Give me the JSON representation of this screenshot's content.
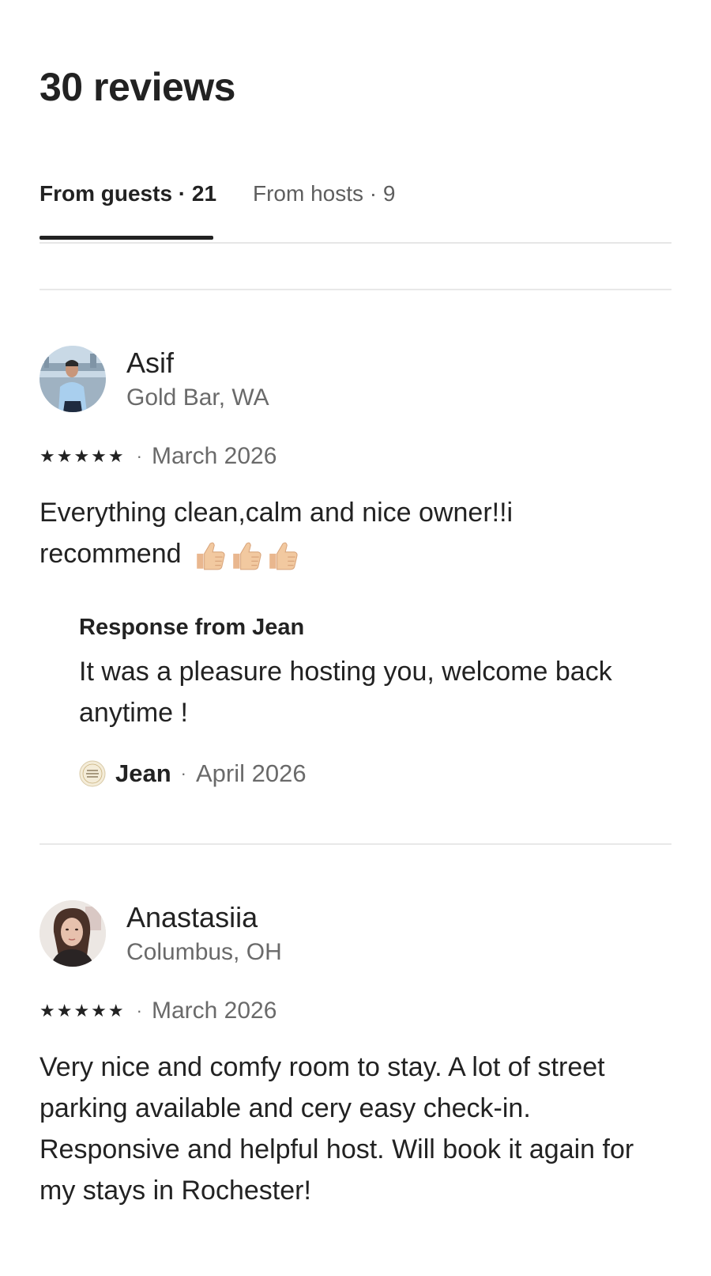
{
  "header": {
    "title": "30 reviews"
  },
  "tabs": [
    {
      "label": "From guests · 21",
      "active": true
    },
    {
      "label": "From hosts · 9",
      "active": false
    }
  ],
  "reviews": [
    {
      "name": "Asif",
      "location": "Gold Bar, WA",
      "rating": 5,
      "stars": "★★★★★",
      "separator": "·",
      "date": "March 2026",
      "text": "Everything clean,calm and nice owner!!i recommend",
      "emoji": [
        "thumbs-up",
        "thumbs-up",
        "thumbs-up"
      ],
      "response": {
        "title": "Response from Jean",
        "text": "It was a pleasure hosting you, welcome back anytime !",
        "host_name": "Jean",
        "separator": "·",
        "date": "April 2026"
      }
    },
    {
      "name": "Anastasiia",
      "location": "Columbus, OH",
      "rating": 5,
      "stars": "★★★★★",
      "separator": "·",
      "date": "March 2026",
      "text": "Very nice and comfy room to stay. A lot of street parking available and cery easy check-in. Responsive and helpful host. Will book it again for my stays in Rochester!"
    }
  ],
  "colors": {
    "text_primary": "#222222",
    "text_secondary": "#6a6a6a",
    "divider": "#e8e8e8",
    "tab_inactive": "#5e5e5e",
    "thumb_skin": "#f2c9a0"
  }
}
